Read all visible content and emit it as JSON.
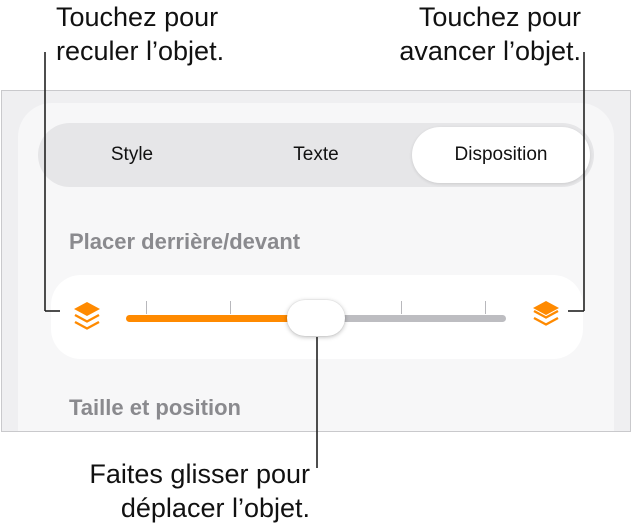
{
  "callouts": {
    "left": [
      "Touchez pour",
      "reculer l’objet."
    ],
    "right": [
      "Touchez pour",
      "avancer l’objet."
    ],
    "bottom": [
      "Faites glisser pour",
      "déplacer l’objet."
    ]
  },
  "tabs": [
    {
      "label": "Style",
      "selected": false
    },
    {
      "label": "Texte",
      "selected": false
    },
    {
      "label": "Disposition",
      "selected": true
    }
  ],
  "sections": {
    "arrange_title": "Placer derrière/devant",
    "size_title": "Taille et position"
  },
  "slider": {
    "value_fraction": 0.5,
    "tick_count": 5,
    "left_icon": "send-backward-icon",
    "right_icon": "bring-forward-icon"
  },
  "colors": {
    "accent": "#ff8a00",
    "track_inactive": "#bdbdc1",
    "section_title": "#8a8a8e",
    "panel_background": "#efeff1"
  }
}
